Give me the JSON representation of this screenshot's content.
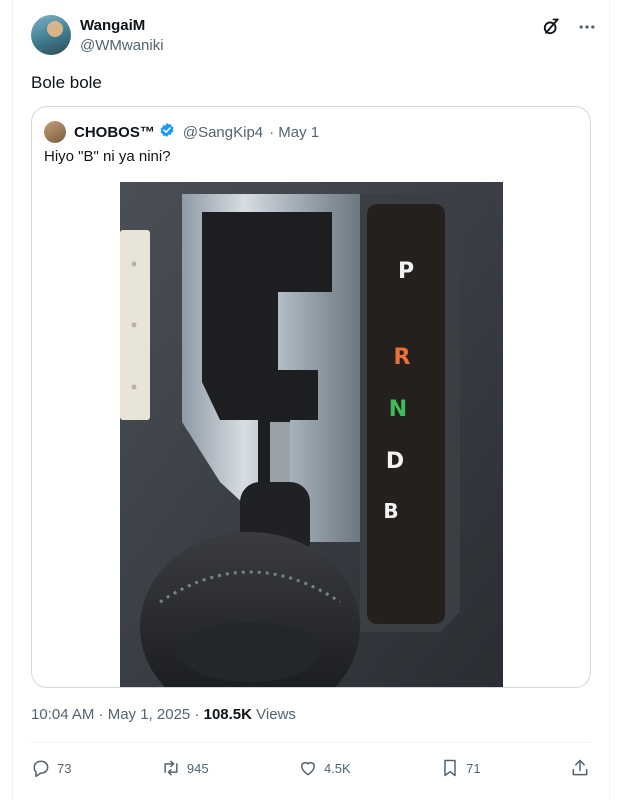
{
  "tweet": {
    "author_name": "WangaiM",
    "author_handle": "@WMwaniki",
    "text": "Bole bole",
    "timestamp": "10:04 AM · May 1, 2025",
    "dot": " · ",
    "views_count": "108.5K",
    "views_label": "Views"
  },
  "quoted": {
    "author_name": "CHOBOS™",
    "author_handle": "@SangKip4",
    "date": "· May 1",
    "text": "Hiyo \"B\" ni ya nini?",
    "gear_labels": [
      "P",
      "R",
      "N",
      "D",
      "B"
    ]
  },
  "actions": {
    "replies": "73",
    "reposts": "945",
    "likes": "4.5K",
    "bookmarks": "71"
  },
  "colors": {
    "text": "#0f1419",
    "secondary": "#536471",
    "verified": "#1d9bf0",
    "gear_white": "#f2f2f2",
    "gear_reverse": "#e8713a",
    "gear_neutral": "#3fbd5a"
  },
  "icons": [
    "grok-icon",
    "more-icon",
    "verified-badge-icon",
    "reply-icon",
    "repost-icon",
    "like-icon",
    "bookmark-icon",
    "share-icon"
  ]
}
